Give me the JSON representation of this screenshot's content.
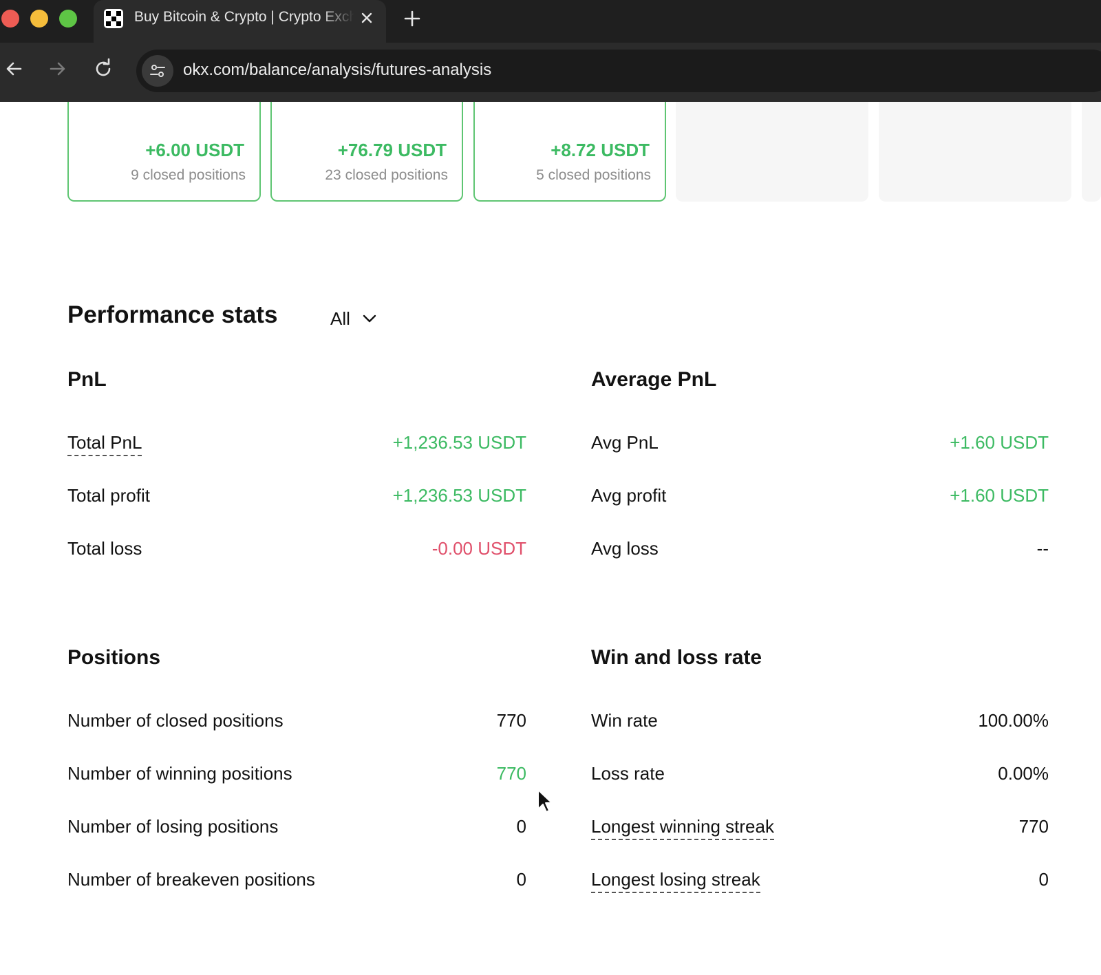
{
  "colors": {
    "positive": "#3cba62",
    "negative": "#e0506b",
    "card_border": "#5ec572"
  },
  "browser": {
    "tab": {
      "title": "Buy Bitcoin & Crypto | Crypto Exchange",
      "favicon": "okx-logo-icon",
      "close_icon": "close-icon"
    },
    "new_tab_icon": "plus-icon",
    "nav": {
      "back_icon": "arrow-left-icon",
      "forward_icon": "arrow-right-icon",
      "reload_icon": "reload-icon"
    },
    "site_info_icon": "tune-icon",
    "url": "okx.com/balance/analysis/futures-analysis"
  },
  "cards": [
    {
      "value": "+6.00 USDT",
      "sub": "9 closed positions"
    },
    {
      "value": "+76.79 USDT",
      "sub": "23 closed positions"
    },
    {
      "value": "+8.72 USDT",
      "sub": "5 closed positions"
    }
  ],
  "performance": {
    "title": "Performance stats",
    "filter": {
      "label": "All",
      "icon": "chevron-down-icon"
    }
  },
  "pnl": {
    "title": "PnL",
    "rows": [
      {
        "label": "Total PnL",
        "value": "+1,236.53 USDT"
      },
      {
        "label": "Total profit",
        "value": "+1,236.53 USDT"
      },
      {
        "label": "Total loss",
        "value": "-0.00 USDT"
      }
    ]
  },
  "avg_pnl": {
    "title": "Average PnL",
    "rows": [
      {
        "label": "Avg PnL",
        "value": "+1.60 USDT"
      },
      {
        "label": "Avg profit",
        "value": "+1.60 USDT"
      },
      {
        "label": "Avg loss",
        "value": "--"
      }
    ]
  },
  "positions": {
    "title": "Positions",
    "rows": [
      {
        "label": "Number of closed positions",
        "value": "770"
      },
      {
        "label": "Number of winning positions",
        "value": "770"
      },
      {
        "label": "Number of losing positions",
        "value": "0"
      },
      {
        "label": "Number of breakeven positions",
        "value": "0"
      }
    ]
  },
  "win_loss": {
    "title": "Win and loss rate",
    "rows": [
      {
        "label": "Win rate",
        "value": "100.00%"
      },
      {
        "label": "Loss rate",
        "value": "0.00%"
      },
      {
        "label": "Longest winning streak",
        "value": "770"
      },
      {
        "label": "Longest losing streak",
        "value": "0"
      }
    ]
  }
}
